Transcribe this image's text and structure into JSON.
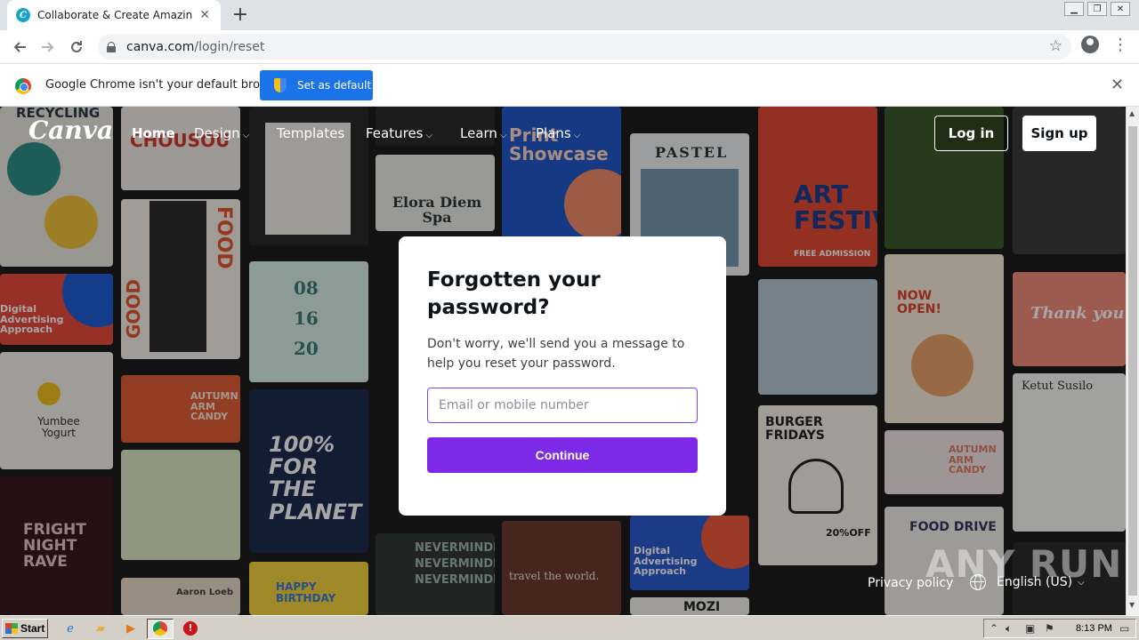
{
  "browser": {
    "tab_title": "Collaborate & Create Amazing Graphic Designs for Free",
    "tab_favicon_letter": "C",
    "url_host": "canva.com",
    "url_path": "/login/reset",
    "infobar_text": "Google Chrome isn't your default browser",
    "set_default_label": "Set as default"
  },
  "nav": {
    "logo": "Canva",
    "links": [
      {
        "label": "Home"
      },
      {
        "label": "Design"
      },
      {
        "label": "Templates"
      },
      {
        "label": "Features"
      },
      {
        "label": "Learn"
      },
      {
        "label": "Plans"
      }
    ],
    "login_label": "Log in",
    "signup_label": "Sign up"
  },
  "card": {
    "title": "Forgotten your password?",
    "description": "Don't worry, we'll send you a message to help you reset your password.",
    "input_placeholder": "Email or mobile number",
    "input_value": "",
    "continue_label": "Continue"
  },
  "background_text": {
    "recycling": "RECYCLING",
    "chousou": "CHOUSOU",
    "food": "FOOD",
    "good": "GOOD",
    "elora": "Elora Diem Spa",
    "pastel": "PASTEL",
    "art_festival": "ART FESTIVAL",
    "free_admission": "FREE ADMISSION",
    "print_showcase": "Print Showcase",
    "digital_advertising": "Digital Advertising Approach",
    "yumbee": "Yumbee Yogurt",
    "autumn_arm_candy": "AUTUMN ARM CANDY",
    "date_08": "08",
    "date_16": "16",
    "date_20": "20",
    "now_open": "NOW OPEN!",
    "thank_you": "Thank you",
    "ketut": "Ketut Susilo",
    "burger_fridays": "BURGER FRIDAYS",
    "off": "20%OFF",
    "for_the_planet": "100% FOR THE PLANET",
    "fright_night": "FRIGHT NIGHT RAVE",
    "neverminder": "NEVERMINDER",
    "travel": "travel the world.",
    "food_drive": "FOOD DRIVE",
    "happy_birthday": "HAPPY BIRTHDAY",
    "aaron": "Aaron Loeb",
    "moz": "MOZI"
  },
  "footer": {
    "privacy_label": "Privacy policy",
    "language_label": "English (US)",
    "watermark": "ANY RUN"
  },
  "taskbar": {
    "start_label": "Start",
    "clock": "8:13 PM"
  },
  "colors": {
    "accent_purple": "#7d2ae8",
    "input_border": "#8b3dff",
    "chrome_blue": "#1a73e8"
  }
}
